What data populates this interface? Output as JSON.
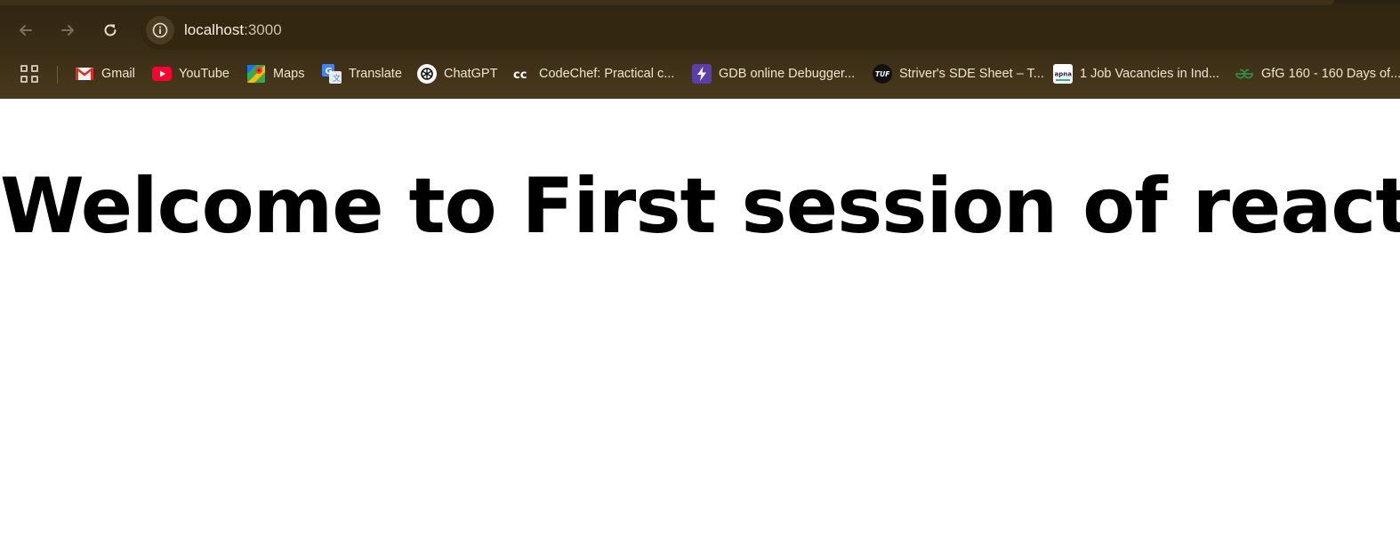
{
  "browser": {
    "address_bar": {
      "host": "localhost",
      "port": ":3000"
    },
    "nav": {
      "back_icon": "arrow-left-icon",
      "forward_icon": "arrow-right-icon",
      "reload_icon": "reload-icon",
      "site_info_icon": "info-icon"
    },
    "bookmarks": [
      {
        "label": "Gmail",
        "icon": "gmail-icon"
      },
      {
        "label": "YouTube",
        "icon": "youtube-icon"
      },
      {
        "label": "Maps",
        "icon": "maps-icon"
      },
      {
        "label": "Translate",
        "icon": "translate-icon"
      },
      {
        "label": "ChatGPT",
        "icon": "chatgpt-icon"
      },
      {
        "label": "CodeChef: Practical c...",
        "icon": "codechef-icon"
      },
      {
        "label": "GDB online Debugger...",
        "icon": "gdb-icon"
      },
      {
        "label": "Striver's SDE Sheet – T...",
        "icon": "tuf-icon"
      },
      {
        "label": "1 Job Vacancies in Ind...",
        "icon": "apna-icon"
      },
      {
        "label": "GfG 160 - 160 Days of...",
        "icon": "gfg-icon"
      }
    ],
    "colors": {
      "chrome_bg": "#3a2d16",
      "omnibox_bg": "#33270f",
      "text": "#ece4d3"
    }
  },
  "page": {
    "heading": "Welcome to First session of react"
  }
}
